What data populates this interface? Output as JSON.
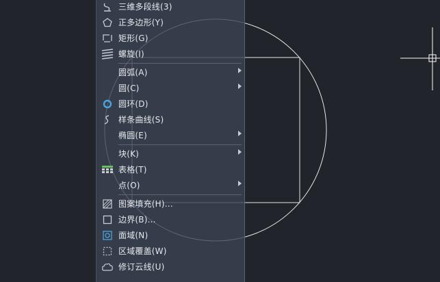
{
  "menu": {
    "items": [
      {
        "label": "三维多段线(3)",
        "icon": "3d-polyline-icon",
        "submenu": false
      },
      {
        "label": "正多边形(Y)",
        "icon": "polygon-icon",
        "submenu": false
      },
      {
        "label": "矩形(G)",
        "icon": "rectangle-icon",
        "submenu": false
      },
      {
        "label": "螺旋(I)",
        "icon": "helix-icon",
        "submenu": false
      },
      {
        "label": "圆弧(A)",
        "icon": "",
        "submenu": true
      },
      {
        "label": "圆(C)",
        "icon": "",
        "submenu": true
      },
      {
        "label": "圆环(D)",
        "icon": "donut-icon",
        "submenu": false
      },
      {
        "label": "样条曲线(S)",
        "icon": "spline-icon",
        "submenu": false
      },
      {
        "label": "椭圆(E)",
        "icon": "",
        "submenu": true
      },
      {
        "label": "块(K)",
        "icon": "",
        "submenu": true
      },
      {
        "label": "表格(T)",
        "icon": "table-icon",
        "submenu": false
      },
      {
        "label": "点(O)",
        "icon": "",
        "submenu": true
      },
      {
        "label": "图案填充(H)...",
        "icon": "hatch-icon",
        "submenu": false
      },
      {
        "label": "边界(B)...",
        "icon": "boundary-icon",
        "submenu": false
      },
      {
        "label": "面域(N)",
        "icon": "region-icon",
        "submenu": false
      },
      {
        "label": "区域覆盖(W)",
        "icon": "wipeout-icon",
        "submenu": false
      },
      {
        "label": "修订云线(U)",
        "icon": "revcloud-icon",
        "submenu": false
      }
    ]
  },
  "colors": {
    "background": "#21252b",
    "menu_bg": "#3b4453",
    "text": "#e6e8ec",
    "geometry": "#ffffff",
    "accent_blue": "#4da3e0"
  }
}
